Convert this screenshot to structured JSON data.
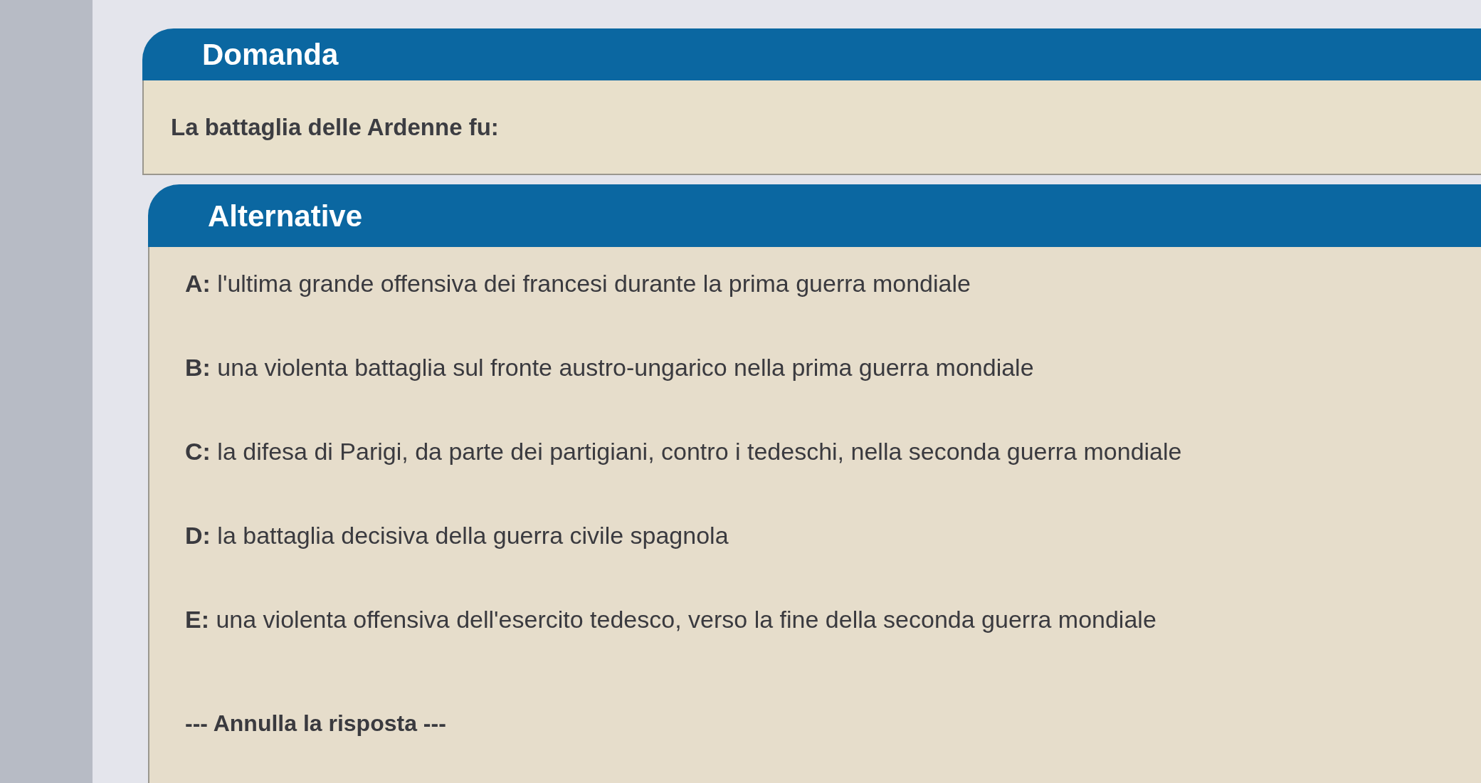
{
  "question_section": {
    "title": "Domanda",
    "text": "La battaglia delle Ardenne fu:"
  },
  "answers_section": {
    "title": "Alternative",
    "options": [
      {
        "text": "**A:** l'ultima grande offensiva dei francesi durante la prima guerra mondiale"
      },
      {
        "text": "**B:** una violenta battaglia sul fronte austro-ungarico nella prima guerra mondiale"
      },
      {
        "text": "**C:** la difesa di Parigi, da parte dei partigiani, contro i tedeschi, nella seconda guerra mondiale"
      },
      {
        "text": "**D:** la battaglia decisiva della guerra civile spagnola"
      },
      {
        "text": "**E:** una violenta offensiva dell'esercito tedesco, verso la fine della seconda guerra mondiale"
      }
    ],
    "cancel_link": "--- Annulla la risposta ---"
  }
}
